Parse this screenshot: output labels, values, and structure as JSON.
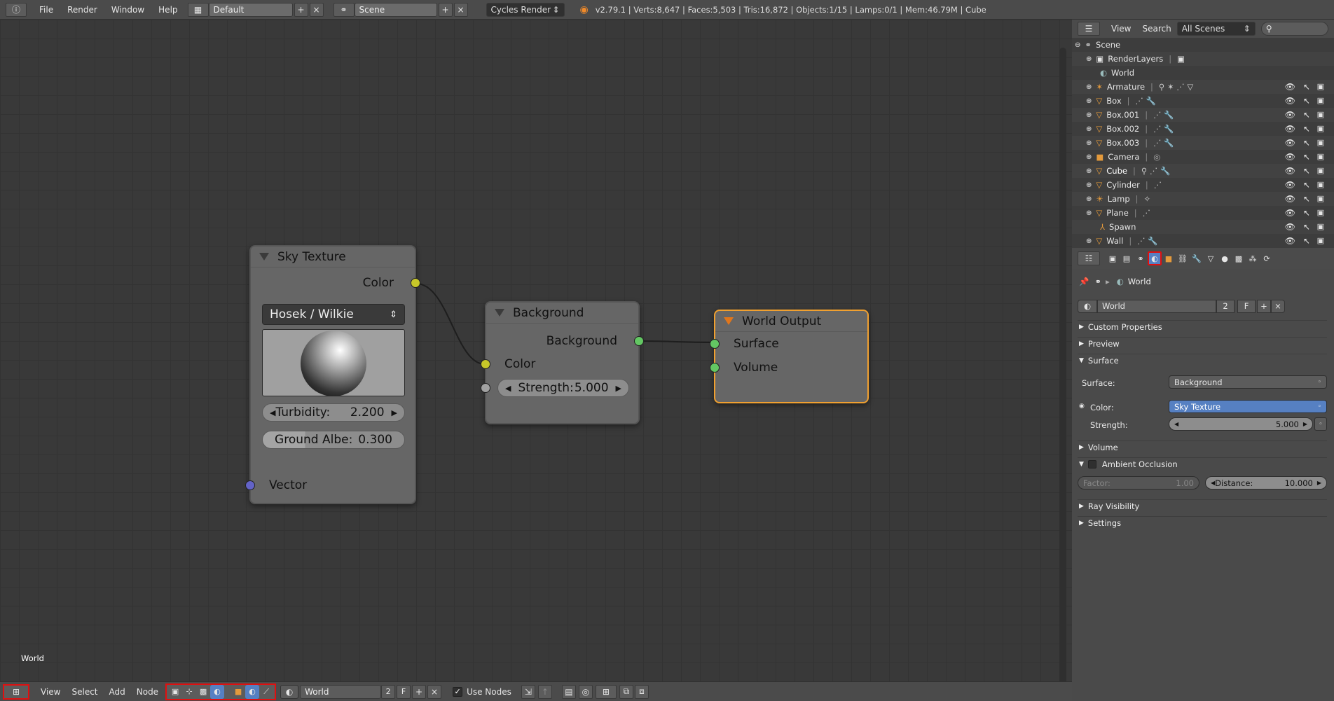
{
  "topbar": {
    "menus": [
      "File",
      "Render",
      "Window",
      "Help"
    ],
    "layout_name": "Default",
    "scene_name": "Scene",
    "engine": "Cycles Render",
    "stats": "v2.79.1 | Verts:8,647 | Faces:5,503 | Tris:16,872 | Objects:1/15 | Lamps:0/1 | Mem:46.79M | Cube"
  },
  "nodes": {
    "sky": {
      "title": "Sky Texture",
      "out_color": "Color",
      "model": "Hosek / Wilkie",
      "turbidity_label": "Turbidity:",
      "turbidity_value": "2.200",
      "albedo_label": "Ground Albe:",
      "albedo_value": "0.300",
      "in_vector": "Vector"
    },
    "background": {
      "title": "Background",
      "out_background": "Background",
      "in_color": "Color",
      "strength_label": "Strength:",
      "strength_value": "5.000"
    },
    "output": {
      "title": "World Output",
      "in_surface": "Surface",
      "in_volume": "Volume"
    }
  },
  "editor": {
    "world_label": "World"
  },
  "bottombar": {
    "menus": [
      "View",
      "Select",
      "Add",
      "Node"
    ],
    "world_name": "World",
    "users": "2",
    "fake_user": "F",
    "use_nodes_label": "Use Nodes",
    "use_nodes_checked": true
  },
  "outliner": {
    "menus": [
      "View",
      "Search"
    ],
    "display_mode": "All Scenes",
    "rows": [
      {
        "name": "Scene",
        "indent": 0
      },
      {
        "name": "RenderLayers",
        "indent": 1
      },
      {
        "name": "World",
        "indent": 1
      },
      {
        "name": "Armature",
        "indent": 1
      },
      {
        "name": "Box",
        "indent": 1
      },
      {
        "name": "Box.001",
        "indent": 1
      },
      {
        "name": "Box.002",
        "indent": 1
      },
      {
        "name": "Box.003",
        "indent": 1
      },
      {
        "name": "Camera",
        "indent": 1
      },
      {
        "name": "Cube",
        "indent": 1
      },
      {
        "name": "Cylinder",
        "indent": 1
      },
      {
        "name": "Lamp",
        "indent": 1
      },
      {
        "name": "Plane",
        "indent": 1
      },
      {
        "name": "Spawn",
        "indent": 1
      },
      {
        "name": "Wall",
        "indent": 1
      }
    ]
  },
  "properties": {
    "breadcrumb": "World",
    "world_name": "World",
    "users": "2",
    "fake_user": "F",
    "panels": {
      "custom_properties": "Custom Properties",
      "preview": "Preview",
      "surface": "Surface",
      "volume": "Volume",
      "ambient_occlusion": "Ambient Occlusion",
      "ray_visibility": "Ray Visibility",
      "settings": "Settings"
    },
    "surface_label": "Surface:",
    "surface_value": "Background",
    "color_label": "Color:",
    "color_value": "Sky Texture",
    "strength_label": "Strength:",
    "strength_value": "5.000",
    "factor_label": "Factor:",
    "factor_value": "1.00",
    "distance_label": "Distance:",
    "distance_value": "10.000"
  },
  "colors": {
    "highlight_red": "#e01010",
    "output_node_border": "#f0a030",
    "selected_field": "#5680c2"
  }
}
